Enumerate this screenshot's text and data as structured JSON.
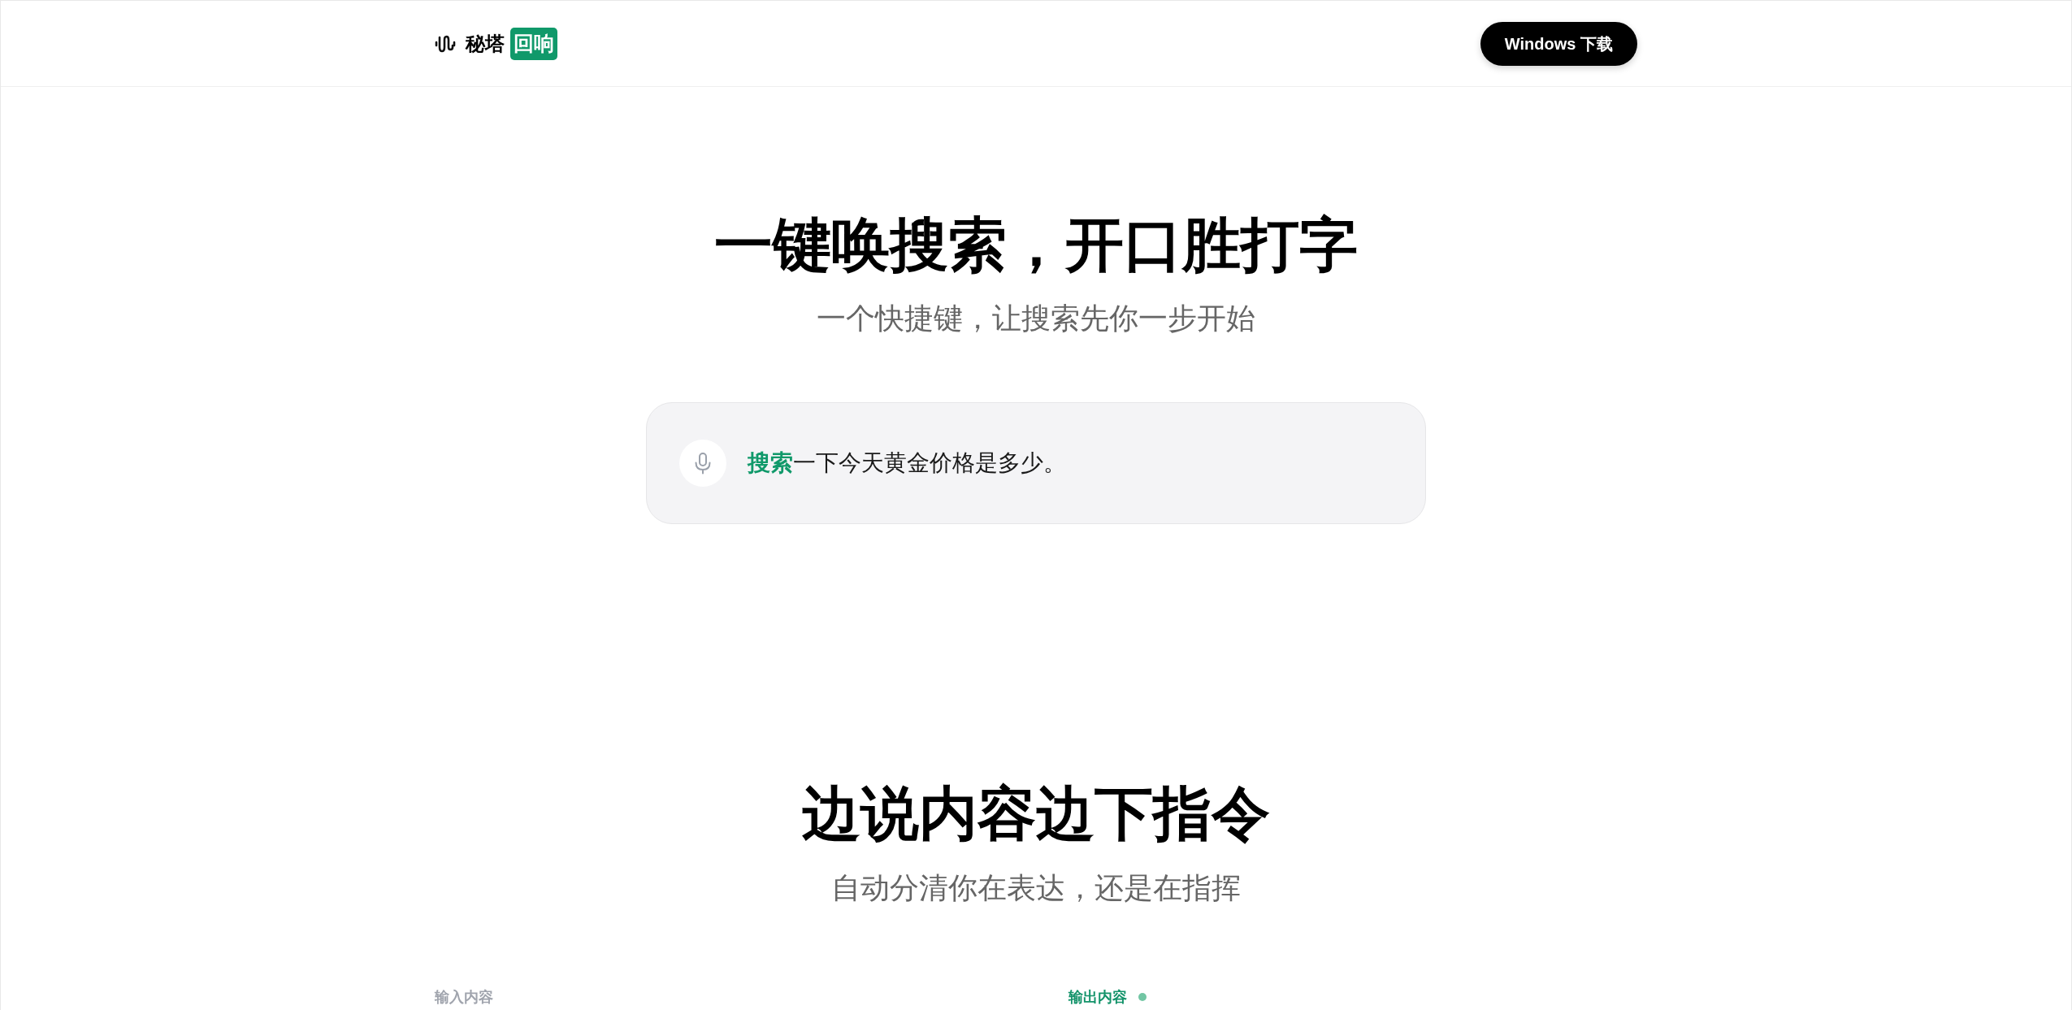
{
  "header": {
    "logo": {
      "name": "秘塔",
      "badge": "回响"
    },
    "download_button": "Windows 下载"
  },
  "hero": {
    "title": "一键唤搜索，开口胜打字",
    "subtitle": "一个快捷键，让搜索先你一步开始",
    "demo_text": "**搜索**一下今天黄金价格是多少。"
  },
  "commands_section": {
    "title": "边说内容边下指令",
    "subtitle": "自动分清你在表达，还是在指挥",
    "panels": [
      {
        "label": "输入内容",
        "active": false
      },
      {
        "label": "输出内容",
        "active": true
      }
    ]
  }
}
